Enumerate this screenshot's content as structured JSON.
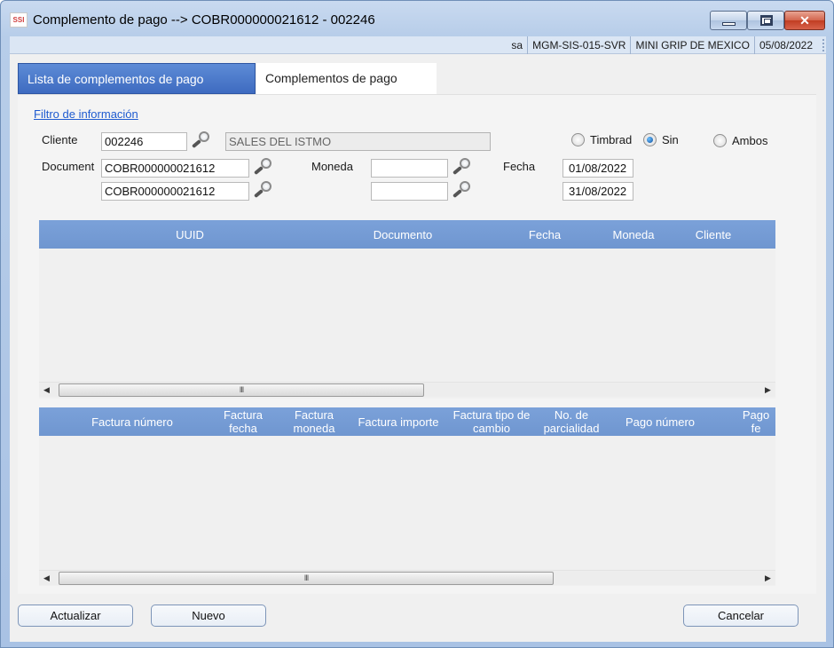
{
  "window": {
    "title": "Complemento de pago --> COBR000000021612 - 002246",
    "app_icon": "SSI"
  },
  "status_bar": {
    "items": [
      "sa",
      "MGM-SIS-015-SVR",
      "MINI GRIP DE MEXICO",
      "05/08/2022"
    ]
  },
  "tabs": [
    {
      "label": "Lista de complementos de pago",
      "active": true
    },
    {
      "label": "Complementos de pago",
      "active": false
    }
  ],
  "filter": {
    "link_label": "Filtro de información",
    "cliente_label": "Cliente",
    "cliente_value": "002246",
    "cliente_name": "SALES DEL ISTMO",
    "document_label": "Document",
    "document_from": "COBR000000021612",
    "document_to": "COBR000000021612",
    "moneda_label": "Moneda",
    "moneda_from": "",
    "moneda_to": "",
    "fecha_label": "Fecha",
    "fecha_from": "01/08/2022",
    "fecha_to": "31/08/2022",
    "radios": [
      {
        "label": "Timbrad",
        "checked": false
      },
      {
        "label": "Sin",
        "checked": true
      },
      {
        "label": "Ambos",
        "checked": false
      }
    ]
  },
  "top_grid": {
    "columns": [
      "UUID",
      "Documento",
      "Fecha",
      "Moneda",
      "Cliente"
    ],
    "rows": []
  },
  "bottom_grid": {
    "columns": [
      "Factura número",
      "Factura fecha",
      "Factura moneda",
      "Factura importe",
      "Factura tipo de cambio",
      "No. de parcialidad",
      "Pago número",
      "Pago fe"
    ],
    "rows": []
  },
  "scroll_thumb_grip": "III",
  "buttons": {
    "actualizar": "Actualizar",
    "nuevo": "Nuevo",
    "cancelar": "Cancelar"
  },
  "colors": {
    "active_tab": "#4a77c8",
    "grid_header": "#7399d3",
    "link": "#1f5bd0"
  }
}
